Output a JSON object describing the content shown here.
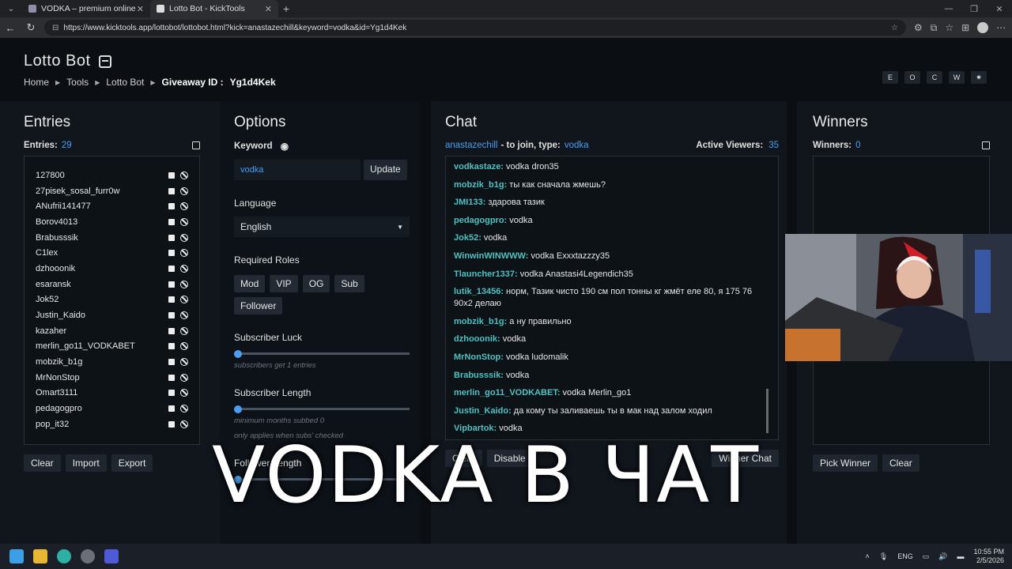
{
  "browser": {
    "tabs": [
      {
        "title": "VODKA – premium online casino",
        "active": false
      },
      {
        "title": "Lotto Bot - KickTools",
        "active": true
      }
    ],
    "url": "https://www.kicktools.app/lottobot/lottobot.html?kick=anastazechill&keyword=vodka&id=Yg1d4Kek"
  },
  "header": {
    "title": "Lotto Bot",
    "breadcrumb": [
      "Home",
      "Tools",
      "Lotto Bot"
    ],
    "giveaway_label": "Giveaway ID :",
    "giveaway_id": "Yg1d4Kek",
    "buttons": [
      "E",
      "O",
      "C",
      "W",
      "✷"
    ]
  },
  "entries": {
    "title": "Entries",
    "count_label": "Entries:",
    "count": "29",
    "list": [
      "127800",
      "27pisek_sosal_furr0w",
      "ANufrii141477",
      "Borov4013",
      "Brabusssik",
      "C1lex",
      "dzhooonik",
      "esaransk",
      "Jok52",
      "Justin_Kaido",
      "kazaher",
      "merlin_go11_VODKABET",
      "mobzik_b1g",
      "MrNonStop",
      "Omart3111",
      "pedagogpro",
      "pop_it32"
    ],
    "buttons": {
      "clear": "Clear",
      "import": "Import",
      "export": "Export"
    }
  },
  "options": {
    "title": "Options",
    "keyword_label": "Keyword",
    "keyword_value": "vodka",
    "update": "Update",
    "language_label": "Language",
    "language_value": "English",
    "roles_label": "Required Roles",
    "roles": [
      "Mod",
      "VIP",
      "OG",
      "Sub",
      "Follower"
    ],
    "sub_luck_label": "Subscriber Luck",
    "sub_luck_hint": "subscribers get 1 entries",
    "sub_length_label": "Subscriber Length",
    "sub_length_hint1": "minimum months subbed 0",
    "sub_length_hint2": "only applies when subs' checked",
    "follower_length_label": "Follower Length"
  },
  "chat": {
    "title": "Chat",
    "channel": "anastazechill",
    "join_text": "- to join, type:",
    "keyword": "vodka",
    "viewers_label": "Active Viewers:",
    "viewers": "35",
    "messages": [
      {
        "user": "vodkastaze:",
        "text": "vodka dron35"
      },
      {
        "user": "mobzik_b1g:",
        "text": "ты как сначала жмешь?"
      },
      {
        "user": "JMI133:",
        "text": "здарова тазик"
      },
      {
        "user": "pedagogpro:",
        "text": "vodka"
      },
      {
        "user": "Jok52:",
        "text": "vodka"
      },
      {
        "user": "WinwinWINWWW:",
        "text": "vodka Exxxtazzzy35"
      },
      {
        "user": "Tlauncher1337:",
        "text": "vodka Anastasi4Legendich35"
      },
      {
        "user": "lutik_13456:",
        "text": "норм, Тазик чисто 190 см пол тонны кг жмёт еле 80, я 175 76 90х2 делаю"
      },
      {
        "user": "mobzik_b1g:",
        "text": "а ну правильно"
      },
      {
        "user": "dzhooonik:",
        "text": "vodka"
      },
      {
        "user": "MrNonStop:",
        "text": "vodka ludomalik"
      },
      {
        "user": "Brabusssik:",
        "text": "vodka"
      },
      {
        "user": "merlin_go11_VODKABET:",
        "text": "vodka Merlin_go1"
      },
      {
        "user": "Justin_Kaido:",
        "text": "да кому ты заливаешь ты в мак над залом ходил"
      },
      {
        "user": "Vipbartok:",
        "text": "vodka"
      }
    ],
    "buttons": {
      "clear": "Clear",
      "disable": "Disable",
      "winner_chat": "Winner Chat"
    }
  },
  "winners": {
    "title": "Winners",
    "count_label": "Winners:",
    "count": "0",
    "pick": "Pick Winner",
    "clear": "Clear"
  },
  "overlay_caption": "VODKA В ЧАТ",
  "taskbar": {
    "lang": "ENG",
    "time": "10:55 PM",
    "date": "2/5/2026"
  }
}
